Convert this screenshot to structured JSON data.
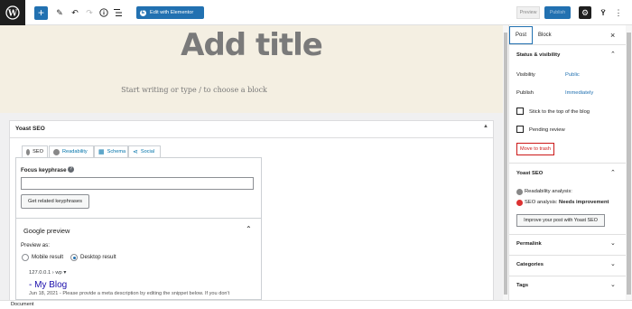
{
  "toolbar": {
    "elementor_label": "Edit with Elementor",
    "preview_label": "Preview",
    "publish_label": "Publish"
  },
  "editor": {
    "title_placeholder": "Add title",
    "block_placeholder": "Start writing or type / to choose a block"
  },
  "yoast_box": {
    "title": "Yoast SEO",
    "tabs": [
      {
        "label": "SEO"
      },
      {
        "label": "Readability"
      },
      {
        "label": "Schema"
      },
      {
        "label": "Social"
      }
    ],
    "focus_keyphrase_label": "Focus keyphrase",
    "focus_keyphrase_value": "",
    "related_button": "Get related keyphrases",
    "google_preview": {
      "title": "Google preview",
      "preview_as": "Preview as:",
      "mobile_option": "Mobile result",
      "desktop_option": "Desktop result",
      "selected": "desktop",
      "url": "127.0.0.1 › wp ▾",
      "snippet_title": "- My Blog",
      "description": "Jun 18, 2021 - Please provide a meta description by editing the snippet below. If you don't"
    }
  },
  "statusbar": {
    "text": "Document"
  },
  "sidebar": {
    "tabs": {
      "post": "Post",
      "block": "Block"
    },
    "status": {
      "title": "Status & visibility",
      "visibility_label": "Visibility",
      "visibility_value": "Public",
      "publish_label": "Publish",
      "publish_value": "Immediately",
      "sticky_label": "Stick to the top of the blog",
      "pending_label": "Pending review",
      "trash_label": "Move to trash"
    },
    "yoast": {
      "title": "Yoast SEO",
      "readability": "Readability analysis:",
      "seo_prefix": "SEO analysis:",
      "seo_status": "Needs improvement",
      "improve_button": "Improve your post with Yoast SEO"
    },
    "panels": {
      "permalink": "Permalink",
      "categories": "Categories",
      "tags": "Tags"
    }
  },
  "colors": {
    "accent": "#2271b1",
    "canvas_bg": "#f4efe2",
    "seo_red": "#dc3232",
    "neutral_dot": "#888888"
  }
}
